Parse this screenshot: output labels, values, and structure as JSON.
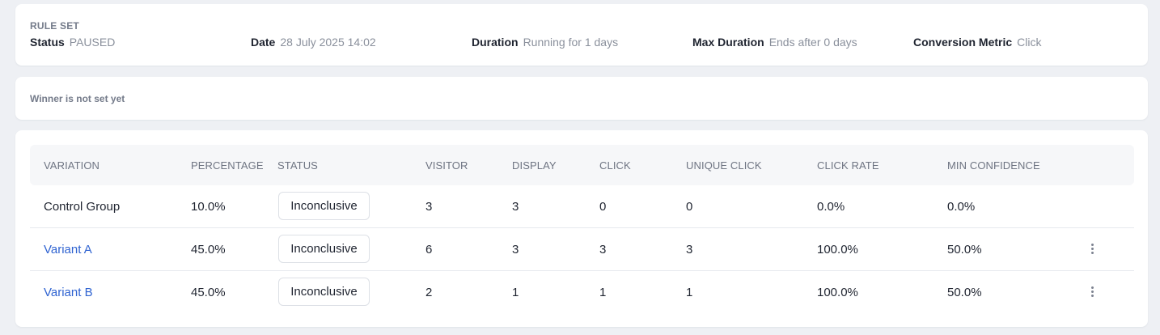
{
  "ruleset": {
    "heading": "RULE SET",
    "items": [
      {
        "key": "Status",
        "value": "PAUSED"
      },
      {
        "key": "Date",
        "value": "28 July 2025 14:02"
      },
      {
        "key": "Duration",
        "value": "Running for 1 days"
      },
      {
        "key": "Max Duration",
        "value": "Ends after 0 days"
      },
      {
        "key": "Conversion Metric",
        "value": "Click"
      }
    ]
  },
  "winner": {
    "text": "Winner is not set yet"
  },
  "table": {
    "columns": [
      "VARIATION",
      "PERCENTAGE",
      "STATUS",
      "VISITOR",
      "DISPLAY",
      "CLICK",
      "UNIQUE CLICK",
      "CLICK RATE",
      "MIN CONFIDENCE"
    ],
    "rows": [
      {
        "variation": "Control Group",
        "percentage": "10.0%",
        "status": "Inconclusive",
        "visitor": "3",
        "display": "3",
        "click": "0",
        "unique_click": "0",
        "click_rate": "0.0%",
        "min_confidence": "0.0%",
        "has_menu": false,
        "is_link": false
      },
      {
        "variation": "Variant A",
        "percentage": "45.0%",
        "status": "Inconclusive",
        "visitor": "6",
        "display": "3",
        "click": "3",
        "unique_click": "3",
        "click_rate": "100.0%",
        "min_confidence": "50.0%",
        "has_menu": true,
        "is_link": true
      },
      {
        "variation": "Variant B",
        "percentage": "45.0%",
        "status": "Inconclusive",
        "visitor": "2",
        "display": "1",
        "click": "1",
        "unique_click": "1",
        "click_rate": "100.0%",
        "min_confidence": "50.0%",
        "has_menu": true,
        "is_link": true
      }
    ],
    "link_color": "#2f63d1",
    "menu_icon": "kebab-menu-icon"
  }
}
